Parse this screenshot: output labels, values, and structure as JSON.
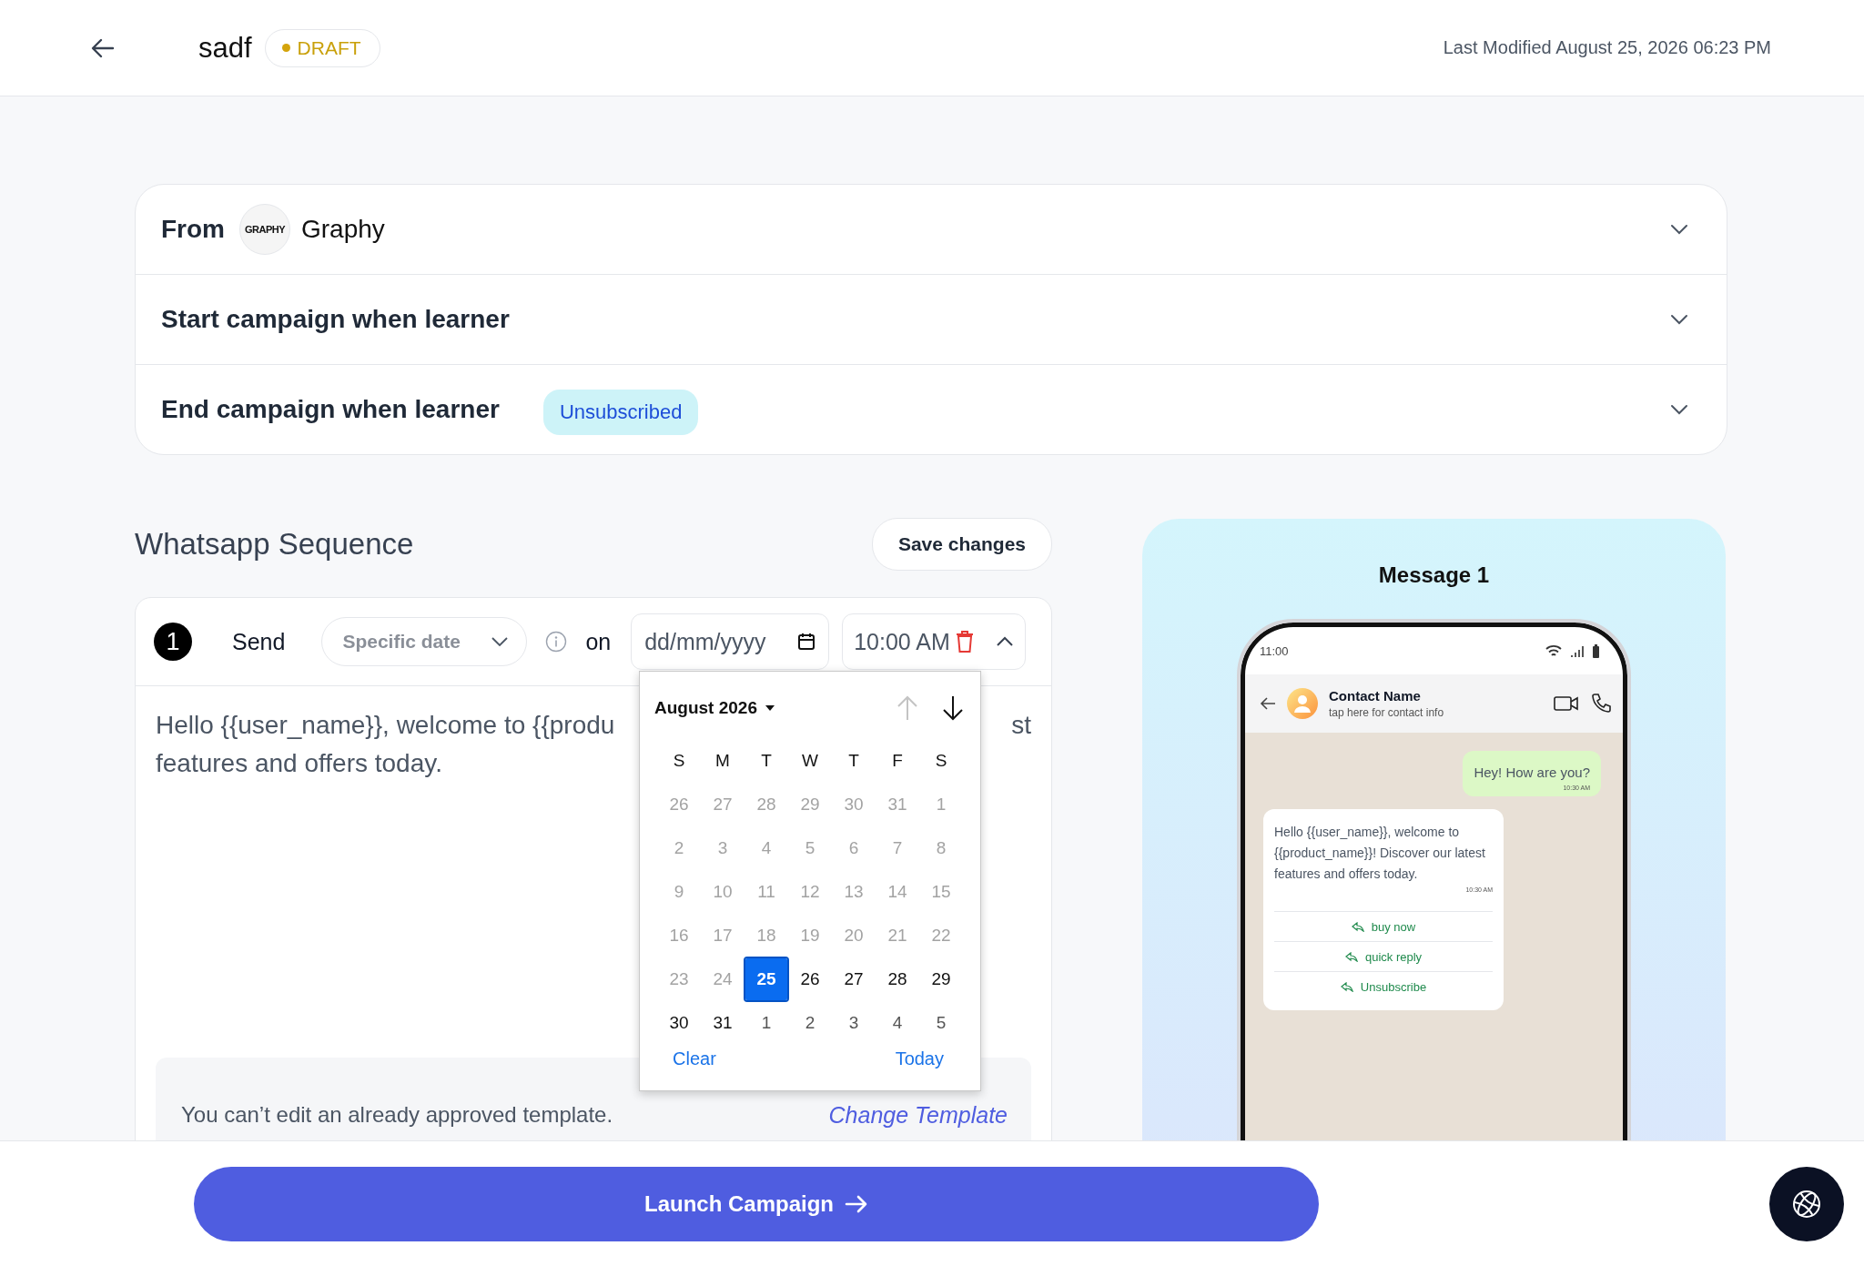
{
  "header": {
    "title": "sadf",
    "status": "DRAFT",
    "last_modified": "Last Modified August 25, 2026 06:23 PM"
  },
  "settings": [
    {
      "label": "From",
      "logo_text": "GRAPHY",
      "value": "Graphy"
    },
    {
      "label": "Start campaign when learner"
    },
    {
      "label": "End campaign when learner",
      "tag": "Unsubscribed"
    }
  ],
  "sequence": {
    "title": "Whatsapp Sequence",
    "save_label": "Save changes",
    "step": {
      "number": "1",
      "send_label": "Send",
      "schedule": "Specific date",
      "on_label": "on",
      "date_placeholder": "dd/mm/yyyy",
      "time": "10:00 AM",
      "message_line_1_start": "Hello {{user_name}}, welcome to {{produ",
      "message_line_1_end": "st",
      "message_line_2": "features and offers today.",
      "note": "You can’t edit an already approved template.",
      "change_link": "Change Template"
    }
  },
  "datepicker": {
    "month": "August 2026",
    "weekdays": [
      "S",
      "M",
      "T",
      "W",
      "T",
      "F",
      "S"
    ],
    "weeks": [
      [
        {
          "day": "26",
          "kind": "disabled",
          "selected": false
        },
        {
          "day": "27",
          "kind": "disabled",
          "selected": false
        },
        {
          "day": "28",
          "kind": "disabled",
          "selected": false
        },
        {
          "day": "29",
          "kind": "disabled",
          "selected": false
        },
        {
          "day": "30",
          "kind": "disabled",
          "selected": false
        },
        {
          "day": "31",
          "kind": "disabled",
          "selected": false
        },
        {
          "day": "1",
          "kind": "disabled",
          "selected": false
        }
      ],
      [
        {
          "day": "2",
          "kind": "disabled",
          "selected": false
        },
        {
          "day": "3",
          "kind": "disabled",
          "selected": false
        },
        {
          "day": "4",
          "kind": "disabled",
          "selected": false
        },
        {
          "day": "5",
          "kind": "disabled",
          "selected": false
        },
        {
          "day": "6",
          "kind": "disabled",
          "selected": false
        },
        {
          "day": "7",
          "kind": "disabled",
          "selected": false
        },
        {
          "day": "8",
          "kind": "disabled",
          "selected": false
        }
      ],
      [
        {
          "day": "9",
          "kind": "disabled",
          "selected": false
        },
        {
          "day": "10",
          "kind": "disabled",
          "selected": false
        },
        {
          "day": "11",
          "kind": "disabled",
          "selected": false
        },
        {
          "day": "12",
          "kind": "disabled",
          "selected": false
        },
        {
          "day": "13",
          "kind": "disabled",
          "selected": false
        },
        {
          "day": "14",
          "kind": "disabled",
          "selected": false
        },
        {
          "day": "15",
          "kind": "disabled",
          "selected": false
        }
      ],
      [
        {
          "day": "16",
          "kind": "disabled",
          "selected": false
        },
        {
          "day": "17",
          "kind": "disabled",
          "selected": false
        },
        {
          "day": "18",
          "kind": "disabled",
          "selected": false
        },
        {
          "day": "19",
          "kind": "disabled",
          "selected": false
        },
        {
          "day": "20",
          "kind": "disabled",
          "selected": false
        },
        {
          "day": "21",
          "kind": "disabled",
          "selected": false
        },
        {
          "day": "22",
          "kind": "disabled",
          "selected": false
        }
      ],
      [
        {
          "day": "23",
          "kind": "disabled",
          "selected": false
        },
        {
          "day": "24",
          "kind": "disabled",
          "selected": false
        },
        {
          "day": "25",
          "kind": "current",
          "selected": true
        },
        {
          "day": "26",
          "kind": "current",
          "selected": false
        },
        {
          "day": "27",
          "kind": "current",
          "selected": false
        },
        {
          "day": "28",
          "kind": "current",
          "selected": false
        },
        {
          "day": "29",
          "kind": "current",
          "selected": false
        }
      ],
      [
        {
          "day": "30",
          "kind": "current",
          "selected": false
        },
        {
          "day": "31",
          "kind": "current",
          "selected": false
        },
        {
          "day": "1",
          "kind": "other_month",
          "selected": false
        },
        {
          "day": "2",
          "kind": "other_month",
          "selected": false
        },
        {
          "day": "3",
          "kind": "other_month",
          "selected": false
        },
        {
          "day": "4",
          "kind": "other_month",
          "selected": false
        },
        {
          "day": "5",
          "kind": "other_month",
          "selected": false
        }
      ]
    ],
    "clear_label": "Clear",
    "today_label": "Today"
  },
  "preview": {
    "title": "Message 1",
    "phone_time": "11:00",
    "contact_name": "Contact Name",
    "contact_subtitle": "tap here for contact info",
    "messages": [
      {
        "kind": "sent",
        "text": "Hey! How are you?",
        "time": "10:30 AM"
      },
      {
        "kind": "received",
        "text": "Hello {{user_name}}, welcome to {{product_name}}! Discover our latest features and offers today.",
        "time": "10:30 AM",
        "buttons": [
          "buy now",
          "quick reply",
          "Unsubscribe"
        ]
      }
    ]
  },
  "footer": {
    "launch_label": "Launch Campaign"
  }
}
